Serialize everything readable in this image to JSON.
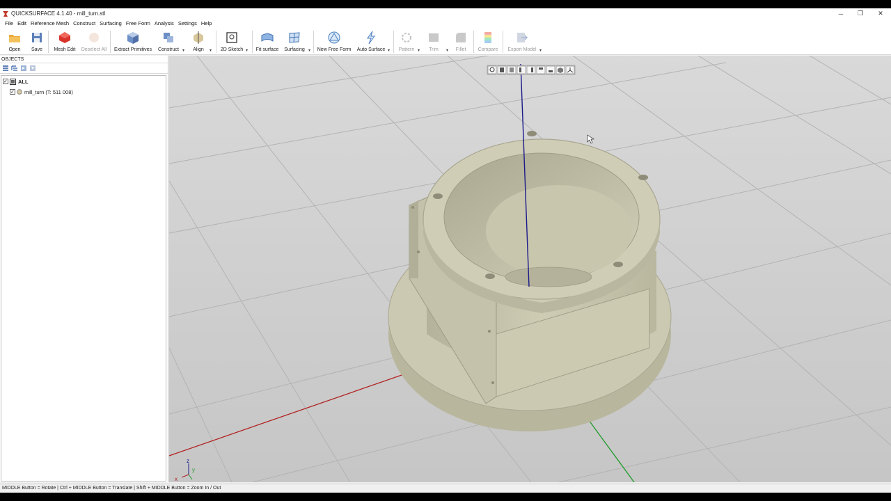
{
  "window": {
    "title": "QUICKSURFACE 4.1.40 - mill_turn.stl",
    "minimize": "─",
    "maximize": "❐",
    "close": "✕"
  },
  "menu": [
    "File",
    "Edit",
    "Reference Mesh",
    "Construct",
    "Surfacing",
    "Free Form",
    "Analysis",
    "Settings",
    "Help"
  ],
  "toolbar": {
    "open": "Open",
    "save": "Save",
    "mesh_edit": "Mesh Edit",
    "deselect_all": "Deselect All",
    "extract_primitives": "Extract Primitives",
    "construct": "Construct",
    "align": "Align",
    "sketch_2d": "2D Sketch",
    "fit_surface": "Fit surface",
    "surfacing": "Surfacing",
    "new_free_form": "New Free Form",
    "auto_surface": "Auto Surface",
    "pattern": "Pattern",
    "trim": "Trim",
    "fillet": "Fillet",
    "compare": "Compare",
    "export_model": "Export Model"
  },
  "objects_panel": {
    "header": "OBJECTS",
    "root_label": "ALL",
    "items": [
      {
        "label": "mill_turn (T: 511 008)",
        "checked": true
      }
    ]
  },
  "triad": {
    "z": "z",
    "x": "x",
    "y": "y"
  },
  "status": "MIDDLE Button = Rotate | Ctrl + MIDDLE Button = Translate | Shift + MIDDLE Button = Zoom In / Out",
  "colors": {
    "viewport_bg": "#cfcfcf",
    "grid": "#b7b7b7",
    "part": "#c9c7b0",
    "axis_x": "#b22222",
    "axis_y": "#1f9a2a",
    "axis_z": "#1a1a8a"
  }
}
